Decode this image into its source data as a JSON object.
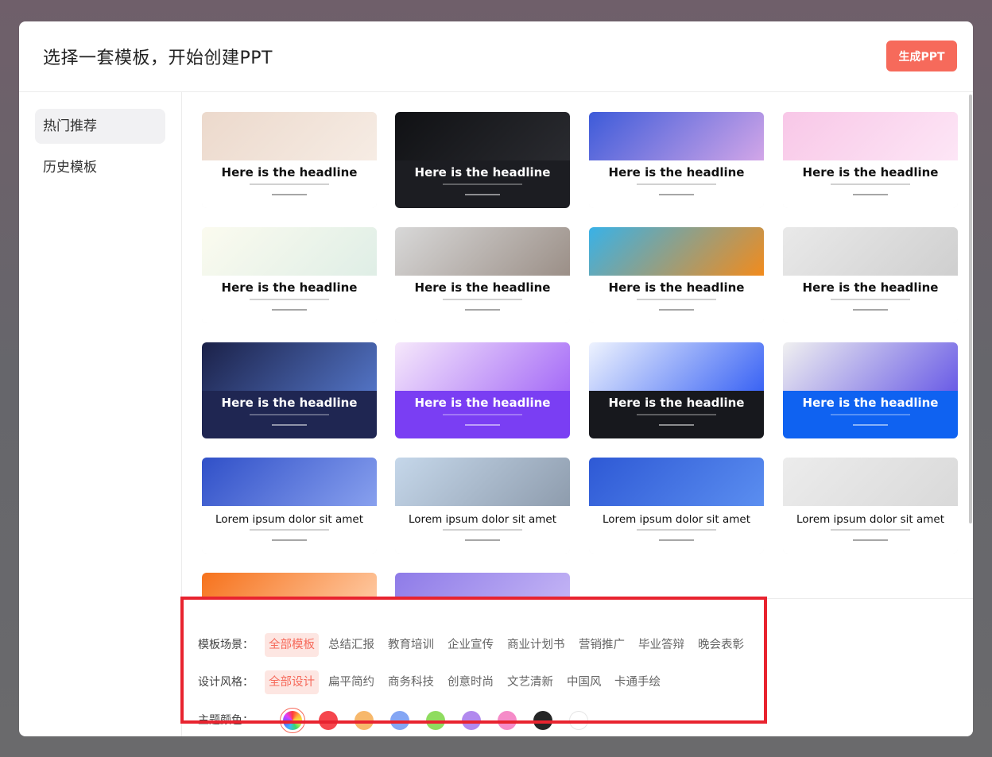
{
  "header": {
    "title": "选择一套模板，开始创建PPT",
    "generate_label": "生成PPT"
  },
  "sidebar": {
    "items": [
      {
        "label": "热门推荐",
        "active": true
      },
      {
        "label": "历史模板",
        "active": false
      }
    ]
  },
  "templates": [
    {
      "headline": "Here is the headline",
      "theme": "light",
      "image": "beige-circle",
      "colors": [
        "#ecd9cc",
        "#f6ece4",
        "#ffffff"
      ]
    },
    {
      "headline": "Here is the headline",
      "theme": "dark",
      "image": "molecule",
      "colors": [
        "#101114",
        "#2a2b30",
        "#1c1d22"
      ]
    },
    {
      "headline": "Here is the headline",
      "theme": "light",
      "image": "fluid-blue",
      "colors": [
        "#3d5bd9",
        "#d2a6e8",
        "#ffffff"
      ]
    },
    {
      "headline": "Here is the headline",
      "theme": "light",
      "image": "pink-ring",
      "colors": [
        "#f8c7e7",
        "#fde6f6",
        "#ffffff"
      ]
    },
    {
      "headline": "Here is the headline",
      "theme": "light",
      "image": "mint-glass",
      "colors": [
        "#fbfbef",
        "#dfeee6",
        "#ffffff"
      ]
    },
    {
      "headline": "Here is the headline",
      "theme": "light",
      "image": "magazine",
      "colors": [
        "#d8d8d8",
        "#9b8f87",
        "#ffffff"
      ]
    },
    {
      "headline": "Here is the headline",
      "theme": "light",
      "image": "orange-water",
      "colors": [
        "#38b2e8",
        "#f28b1c",
        "#ffffff"
      ]
    },
    {
      "headline": "Here is the headline",
      "theme": "light",
      "image": "white-waves",
      "colors": [
        "#e9e9e9",
        "#cfcfcf",
        "#ffffff"
      ]
    },
    {
      "headline": "Here is the headline",
      "theme": "dark",
      "image": "navy-shapes",
      "colors": [
        "#1b2148",
        "#5273c4",
        "#1f2652"
      ]
    },
    {
      "headline": "Here is the headline",
      "theme": "dark",
      "image": "purple-blobs",
      "colors": [
        "#f6e8fb",
        "#a56bf7",
        "#7a3ef3"
      ]
    },
    {
      "headline": "Here is the headline",
      "theme": "dark",
      "image": "blue-blocks",
      "colors": [
        "#eef3fe",
        "#3a63f4",
        "#17181d"
      ]
    },
    {
      "headline": "Here is the headline",
      "theme": "dark",
      "image": "illustration",
      "colors": [
        "#f0f0f0",
        "#6a5ce6",
        "#0f62f1"
      ]
    },
    {
      "headline": "Lorem ipsum dolor sit amet",
      "theme": "light",
      "image": "glass-buildings",
      "colors": [
        "#3050c8",
        "#88a0ee",
        "#ffffff"
      ]
    },
    {
      "headline": "Lorem ipsum dolor sit amet",
      "theme": "light",
      "image": "tower",
      "colors": [
        "#c5d7ea",
        "#8e9cad",
        "#ffffff"
      ]
    },
    {
      "headline": "Lorem ipsum dolor sit amet",
      "theme": "light",
      "image": "blue-circles",
      "colors": [
        "#2e59d5",
        "#5b8ef0",
        "#ffffff"
      ]
    },
    {
      "headline": "Lorem ipsum dolor sit amet",
      "theme": "light",
      "image": "white-ribbon",
      "colors": [
        "#ececec",
        "#d9d9d9",
        "#ffffff"
      ]
    },
    {
      "headline": "",
      "theme": "light",
      "image": "orange",
      "colors": [
        "#f6721c",
        "#ffd1ae",
        "#ffffff"
      ]
    },
    {
      "headline": "",
      "theme": "light",
      "image": "violet",
      "colors": [
        "#8e7be8",
        "#c8b9f6",
        "#ffffff"
      ]
    }
  ],
  "filters": {
    "scene": {
      "label": "模板场景：",
      "options": [
        "全部模板",
        "总结汇报",
        "教育培训",
        "企业宣传",
        "商业计划书",
        "营销推广",
        "毕业答辩",
        "晚会表彰"
      ],
      "selected": 0
    },
    "style": {
      "label": "设计风格：",
      "options": [
        "全部设计",
        "扁平简约",
        "商务科技",
        "创意时尚",
        "文艺清新",
        "中国风",
        "卡通手绘"
      ],
      "selected": 0
    },
    "color": {
      "label": "主题颜色：",
      "swatches": [
        {
          "name": "all-colors",
          "color": "rainbow"
        },
        {
          "name": "red",
          "color": "#f5464d"
        },
        {
          "name": "orange",
          "color": "#f7b86b"
        },
        {
          "name": "blue",
          "color": "#84a6f4"
        },
        {
          "name": "green",
          "color": "#8fdc5f"
        },
        {
          "name": "purple",
          "color": "#b189ee"
        },
        {
          "name": "pink",
          "color": "#f58bc8"
        },
        {
          "name": "black",
          "color": "#262626"
        },
        {
          "name": "white",
          "color": "#ffffff"
        }
      ],
      "selected": 0
    }
  }
}
